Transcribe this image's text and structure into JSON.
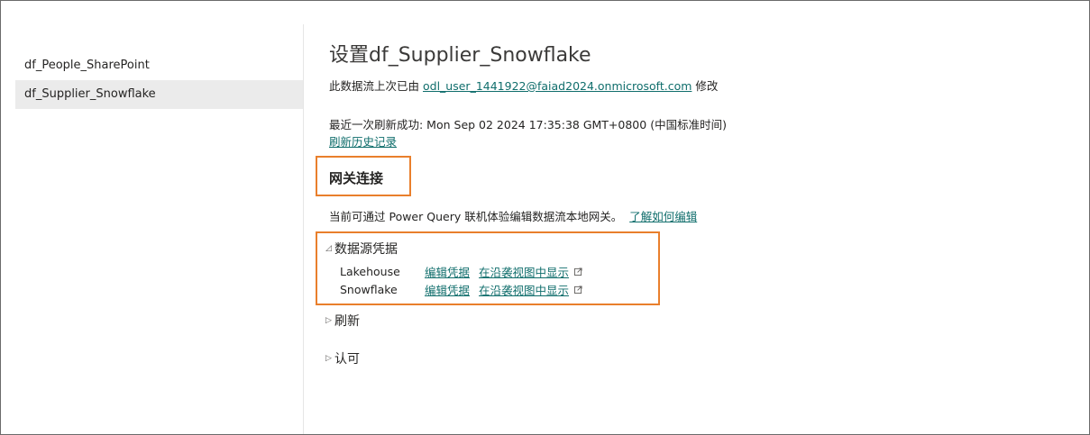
{
  "sidebar": {
    "items": [
      {
        "label": "df_People_SharePoint"
      },
      {
        "label": "df_Supplier_Snowflake"
      }
    ]
  },
  "main": {
    "title": "设置df_Supplier_Snowflake",
    "modified": {
      "prefix": "此数据流上次已由",
      "user": "odl_user_1441922@faiad2024.onmicrosoft.com",
      "suffix": "修改"
    },
    "last_refresh": "最近一次刷新成功: Mon Sep 02 2024 17:35:38 GMT+0800 (中国标准时间)",
    "refresh_history_link": "刷新历史记录",
    "gateway": {
      "heading": "网关连接",
      "description": "当前可通过 Power Query 联机体验编辑数据流本地网关。",
      "learn_link": "了解如何编辑"
    },
    "credentials": {
      "heading": "数据源凭据",
      "rows": [
        {
          "name": "Lakehouse",
          "edit": "编辑凭据",
          "lineage": "在沿袭视图中显示"
        },
        {
          "name": "Snowflake",
          "edit": "编辑凭据",
          "lineage": "在沿袭视图中显示"
        }
      ]
    },
    "refresh_section": "刷新",
    "endorsement_section": "认可"
  },
  "colors": {
    "accent_link": "#106e6c",
    "highlight_box": "#e97f2c",
    "selected_bg": "#ebebeb"
  }
}
